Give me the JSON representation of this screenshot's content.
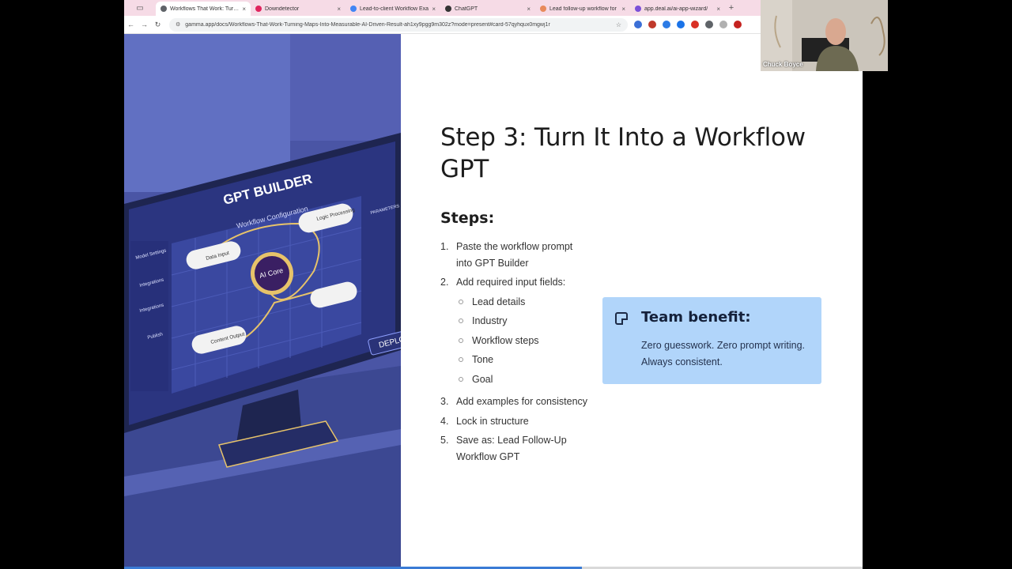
{
  "browser": {
    "tabs": [
      {
        "label": "Workflows That Work: Turnin",
        "active": true,
        "favicon_color": "#5f6368"
      },
      {
        "label": "Downdetector",
        "active": false,
        "favicon_color": "#e0245e"
      },
      {
        "label": "Lead-to-client Workflow Exa",
        "active": false,
        "favicon_color": "#4285f4"
      },
      {
        "label": "ChatGPT",
        "active": false,
        "favicon_color": "#333333"
      },
      {
        "label": "Lead follow-up workflow for",
        "active": false,
        "favicon_color": "#e88a5b"
      },
      {
        "label": "app.deal.ai/ai-app-wizard/",
        "active": false,
        "favicon_color": "#7b4fd8"
      }
    ],
    "url": "gamma.app/docs/Workflows-That-Work-Turning-Maps-Into-Measurable-AI-Driven-Result-ah1xy9pgg9m302z?mode=present#card-57qyhqux0mgwj1r"
  },
  "illustration": {
    "title": "GPT BUILDER",
    "subtitle": "Workflow Configuration",
    "core": "AI Core",
    "nodes": [
      "Data Input",
      "Logic Processing",
      "Content Output"
    ],
    "sidebar": [
      "Model Settings",
      "Integrations",
      "Integrations",
      "Publish"
    ],
    "panel_label": "PARAMETERS",
    "deploy": "DEPLO"
  },
  "slide": {
    "title": "Step 3: Turn It Into a Workflow GPT",
    "steps_heading": "Steps:",
    "steps": [
      {
        "num": "1.",
        "text": "Paste the workflow prompt into GPT Builder"
      },
      {
        "num": "2.",
        "text": "Add required input fields:"
      },
      {
        "num": "3.",
        "text": "Add examples for consistency"
      },
      {
        "num": "4.",
        "text": "Lock in structure"
      },
      {
        "num": "5.",
        "text": "Save as: Lead Follow-Up Workflow GPT"
      }
    ],
    "input_fields": [
      "Lead details",
      "Industry",
      "Workflow steps",
      "Tone",
      "Goal"
    ],
    "callout": {
      "heading": "Team benefit:",
      "body": "Zero guesswork. Zero prompt writing. Always consistent.",
      "background": "#b1d5fa"
    },
    "progress": 0.62
  },
  "webcam": {
    "name": "Chuck Boyce"
  }
}
